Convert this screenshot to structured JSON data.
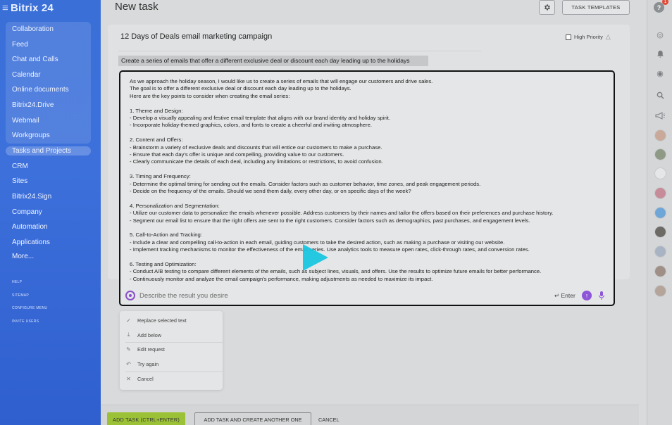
{
  "app": {
    "logo": "Bitrix 24"
  },
  "sidebar": {
    "items": [
      {
        "label": "Collaboration"
      },
      {
        "label": "Feed"
      },
      {
        "label": "Chat and Calls"
      },
      {
        "label": "Calendar"
      },
      {
        "label": "Online documents"
      },
      {
        "label": "Bitrix24.Drive"
      },
      {
        "label": "Webmail"
      },
      {
        "label": "Workgroups"
      },
      {
        "label": "Tasks and Projects"
      },
      {
        "label": "CRM"
      },
      {
        "label": "Sites"
      },
      {
        "label": "Bitrix24.Sign"
      },
      {
        "label": "Company"
      },
      {
        "label": "Automation"
      },
      {
        "label": "Applications"
      },
      {
        "label": "More..."
      }
    ],
    "footer": [
      {
        "label": "HELP"
      },
      {
        "label": "SITEMAP"
      },
      {
        "label": "CONFIGURE MENU"
      },
      {
        "label": "INVITE USERS"
      }
    ]
  },
  "header": {
    "title": "New task",
    "templates_label": "TASK TEMPLATES"
  },
  "task": {
    "title": "12 Days of Deals email marketing campaign",
    "high_priority_label": "High Priority",
    "selected_text": "Create a series of emails that offer a different exclusive deal or discount each day leading up to the holidays"
  },
  "ai_panel": {
    "lines": [
      "As we approach the holiday season, I would like us to create a series of emails that will engage our customers and drive sales.",
      "The goal is to offer a different exclusive deal or discount each day leading up to the holidays.",
      "Here are the key points to consider when creating the email series:",
      "",
      "1. Theme and Design:",
      "- Develop a visually appealing and festive email template that aligns with our brand identity and holiday spirit.",
      "- Incorporate holiday-themed graphics, colors, and fonts to create a cheerful and inviting atmosphere.",
      "",
      "2. Content and Offers:",
      "- Brainstorm a variety of exclusive deals and discounts that will entice our customers to make a purchase.",
      "- Ensure that each day's offer is unique and compelling, providing value to our customers.",
      "- Clearly communicate the details of each deal, including any limitations or restrictions, to avoid confusion.",
      "",
      "3. Timing and Frequency:",
      "- Determine the optimal timing for sending out the emails. Consider factors such as customer behavior, time zones, and peak engagement periods.",
      "- Decide on the frequency of the emails. Should we send them daily, every other day, or on specific days of the week?",
      "",
      "4. Personalization and Segmentation:",
      "- Utilize our customer data to personalize the emails whenever possible. Address customers by their names and tailor the offers based on their preferences and purchase history.",
      "- Segment our email list to ensure that the right offers are sent to the right customers. Consider factors such as demographics, past purchases, and engagement levels.",
      "",
      "5. Call-to-Action and Tracking:",
      "- Include a clear and compelling call-to-action in each email, guiding customers to take the desired action, such as making a purchase or visiting our website.",
      "- Implement tracking mechanisms to monitor the effectiveness of the email series. Use analytics tools to measure open rates, click-through rates, and conversion rates.",
      "",
      "6. Testing and Optimization:",
      "- Conduct A/B testing to compare different elements of the emails, such as subject lines, visuals, and offers. Use the results to optimize future emails for better performance.",
      "- Continuously monitor and analyze the email campaign's performance, making adjustments as needed to maximize its impact."
    ],
    "input_placeholder": "Describe the result you desire",
    "enter_hint": "Enter"
  },
  "ai_menu": {
    "items": [
      {
        "label": "Replace selected text",
        "icon": "check-icon"
      },
      {
        "label": "Add below",
        "icon": "insert-below-icon"
      },
      {
        "label": "Edit request",
        "icon": "pencil-icon"
      },
      {
        "label": "Try again",
        "icon": "undo-icon"
      },
      {
        "label": "Cancel",
        "icon": "close-icon"
      }
    ]
  },
  "footer": {
    "add_task_label": "ADD TASK (CTRL+ENTER)",
    "add_another_label": "ADD TASK AND CREATE ANOTHER ONE",
    "cancel_label": "CANCEL"
  },
  "rail": {
    "help_label": "?",
    "help_badge": "1"
  },
  "colors": {
    "sidebar": "#3a6fd8",
    "accent_purple": "#8d55d8",
    "add_button_green": "#9bc236",
    "cursor_cyan": "#19c7e0"
  }
}
